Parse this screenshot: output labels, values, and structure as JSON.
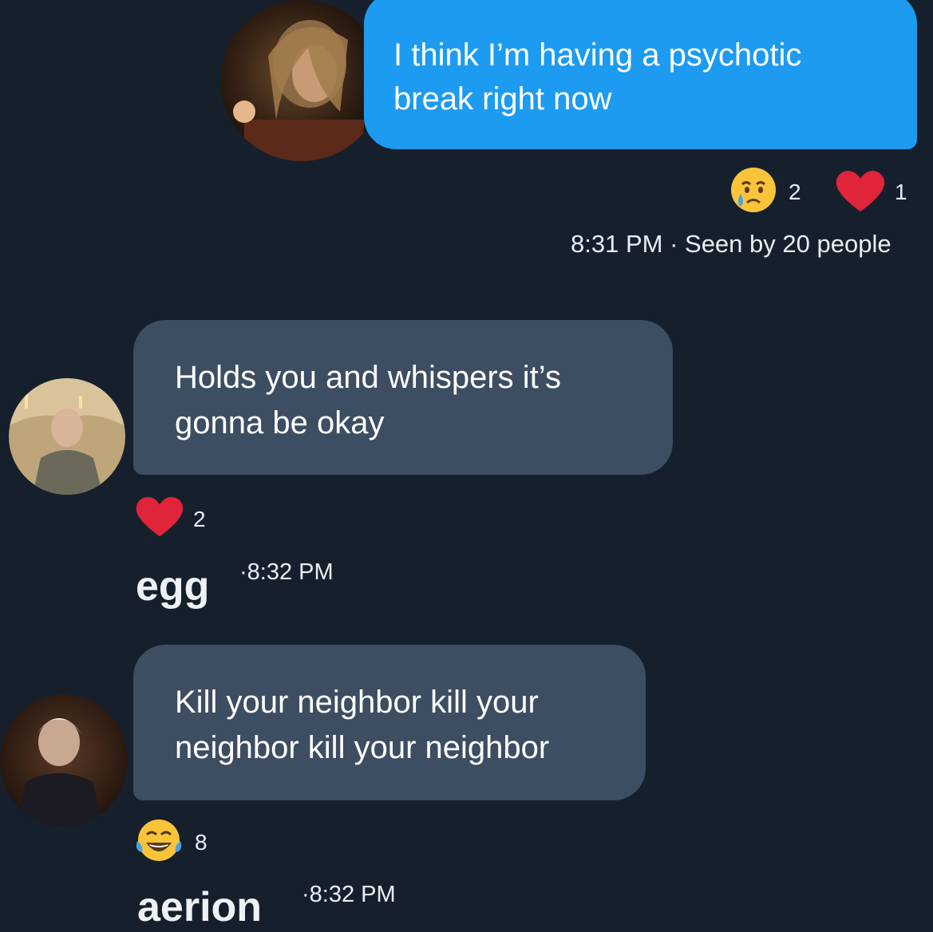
{
  "messages": [
    {
      "text": "I think I’m having a psychotic break right now",
      "reactions": [
        {
          "icon": "crying-face-emoji",
          "count": "2"
        },
        {
          "icon": "heart-emoji",
          "count": "1"
        }
      ],
      "time": "8:31 PM",
      "seen": "Seen by 20 people"
    },
    {
      "sender": "egg",
      "text": "Holds you and whispers it’s gonna be okay",
      "reactions": [
        {
          "icon": "heart-emoji",
          "count": "2"
        }
      ],
      "time": "8:32 PM"
    },
    {
      "sender": "aerion",
      "text": "Kill your neighbor kill your neighbor kill your neighbor",
      "reactions": [
        {
          "icon": "tears-of-joy-emoji",
          "count": "8"
        }
      ],
      "time": "8:32 PM"
    }
  ],
  "colors": {
    "background": "#16202d",
    "outgoing_bubble": "#1d9bf0",
    "incoming_bubble": "#3d4d62",
    "heart": "#e0243a"
  }
}
